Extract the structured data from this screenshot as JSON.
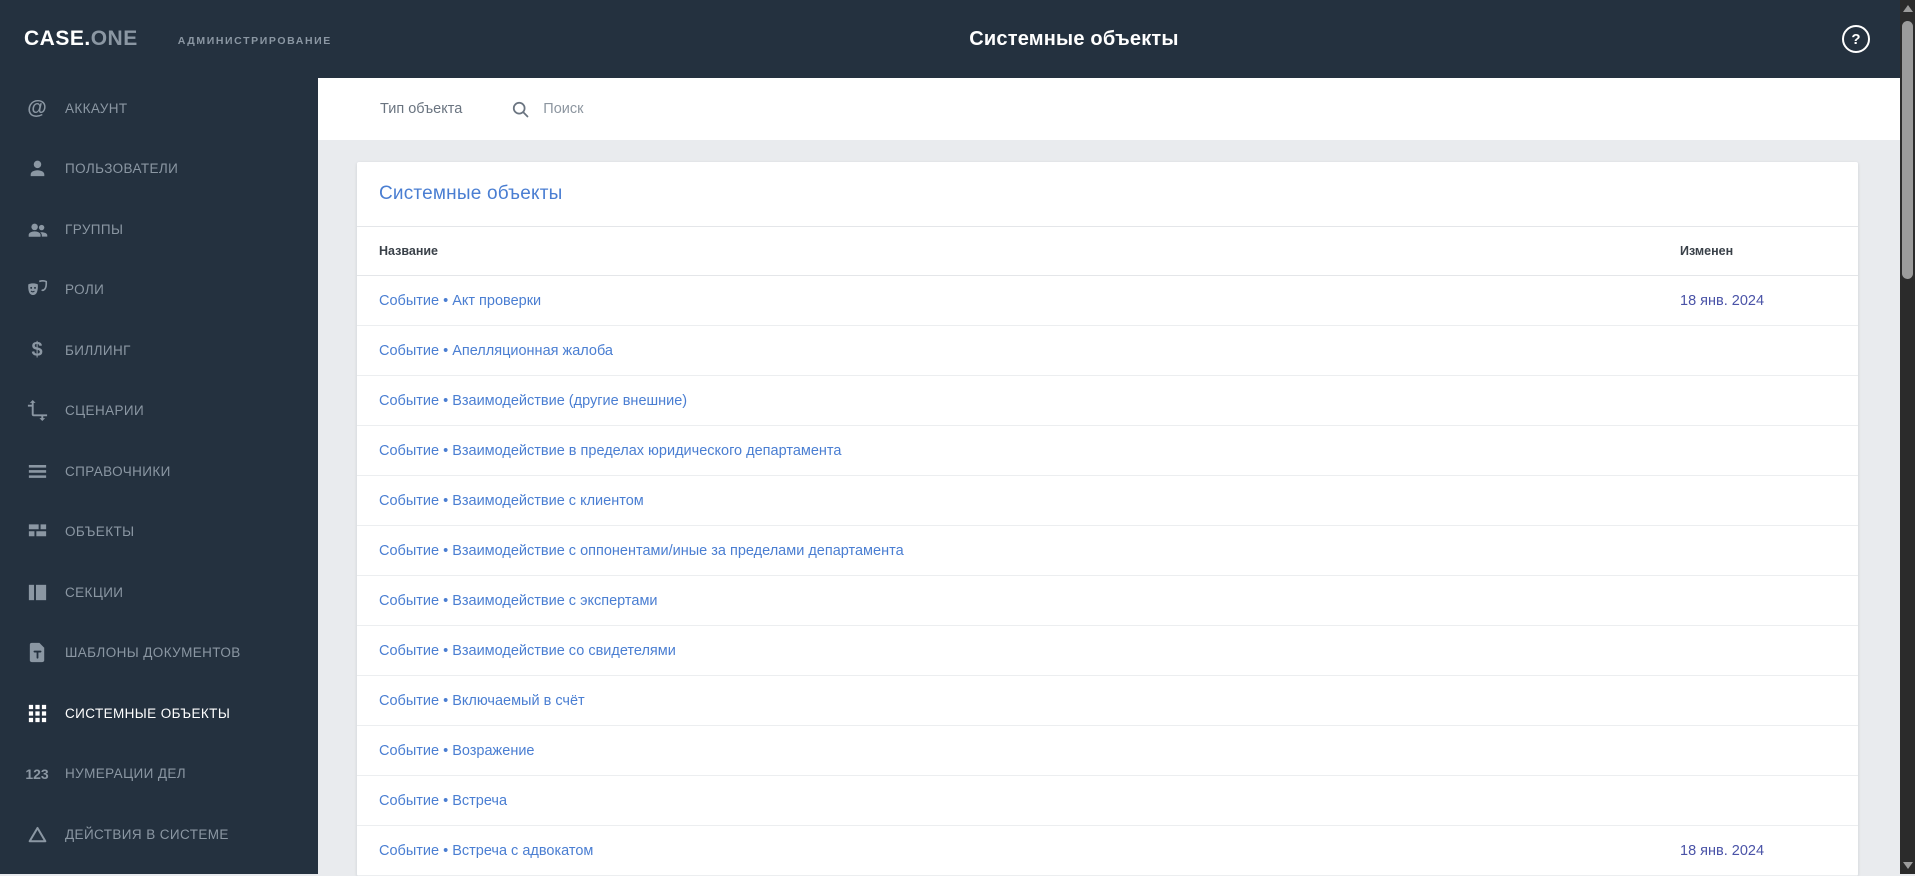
{
  "header": {
    "logo_primary": "CASE.",
    "logo_secondary": "ONE",
    "subtitle": "АДМИНИСТРИРОВАНИЕ",
    "title": "Системные объекты",
    "help_icon": "?"
  },
  "sidebar": {
    "items": [
      {
        "label": "АККАУНТ",
        "icon": "at-icon",
        "active": false
      },
      {
        "label": "ПОЛЬЗОВАТЕЛИ",
        "icon": "person-icon",
        "active": false
      },
      {
        "label": "ГРУППЫ",
        "icon": "group-icon",
        "active": false
      },
      {
        "label": "РОЛИ",
        "icon": "masks-icon",
        "active": false
      },
      {
        "label": "БИЛЛИНГ",
        "icon": "dollar-icon",
        "active": false
      },
      {
        "label": "СЦЕНАРИИ",
        "icon": "transform-icon",
        "active": false
      },
      {
        "label": "СПРАВОЧНИКИ",
        "icon": "list-icon",
        "active": false
      },
      {
        "label": "ОБЪЕКТЫ",
        "icon": "dashboard-icon",
        "active": false
      },
      {
        "label": "СЕКЦИИ",
        "icon": "columns-icon",
        "active": false
      },
      {
        "label": "ШАБЛОНЫ ДОКУМЕНТОВ",
        "icon": "doc-template-icon",
        "active": false
      },
      {
        "label": "СИСТЕМНЫЕ ОБЪЕКТЫ",
        "icon": "apps-grid-icon",
        "active": true
      },
      {
        "label": "НУМЕРАЦИИ ДЕЛ",
        "icon": "numbers-123-icon",
        "active": false
      },
      {
        "label": "ДЕЙСТВИЯ В СИСТЕМЕ",
        "icon": "triangle-icon",
        "active": false
      }
    ]
  },
  "toolbar": {
    "type_filter_label": "Тип объекта",
    "search_icon": "search-icon",
    "search_placeholder": "Поиск",
    "search_value": ""
  },
  "main": {
    "card_title": "Системные объекты",
    "table": {
      "columns": [
        "Название",
        "Изменен"
      ],
      "rows": [
        {
          "name": "Событие • Акт проверки",
          "modified": "18 янв. 2024"
        },
        {
          "name": "Событие • Апелляционная жалоба",
          "modified": ""
        },
        {
          "name": "Событие • Взаимодействие (другие внешние)",
          "modified": ""
        },
        {
          "name": "Событие • Взаимодействие в пределах юридического департамента",
          "modified": ""
        },
        {
          "name": "Событие • Взаимодействие с клиентом",
          "modified": ""
        },
        {
          "name": "Событие • Взаимодействие с оппонентами/иные за пределами департамента",
          "modified": ""
        },
        {
          "name": "Событие • Взаимодействие с экспертами",
          "modified": ""
        },
        {
          "name": "Событие • Взаимодействие со свидетелями",
          "modified": ""
        },
        {
          "name": "Событие • Включаемый в счёт",
          "modified": ""
        },
        {
          "name": "Событие • Возражение",
          "modified": ""
        },
        {
          "name": "Событие • Встреча",
          "modified": ""
        },
        {
          "name": "Событие • Встреча с адвокатом",
          "modified": "18 янв. 2024"
        }
      ]
    }
  },
  "colors": {
    "navy": "#24313f",
    "sidebar_text": "#8b97a3",
    "link_blue": "#4a7ed2",
    "date_indigo": "#4a53a7",
    "content_bg": "#e9ebee"
  }
}
